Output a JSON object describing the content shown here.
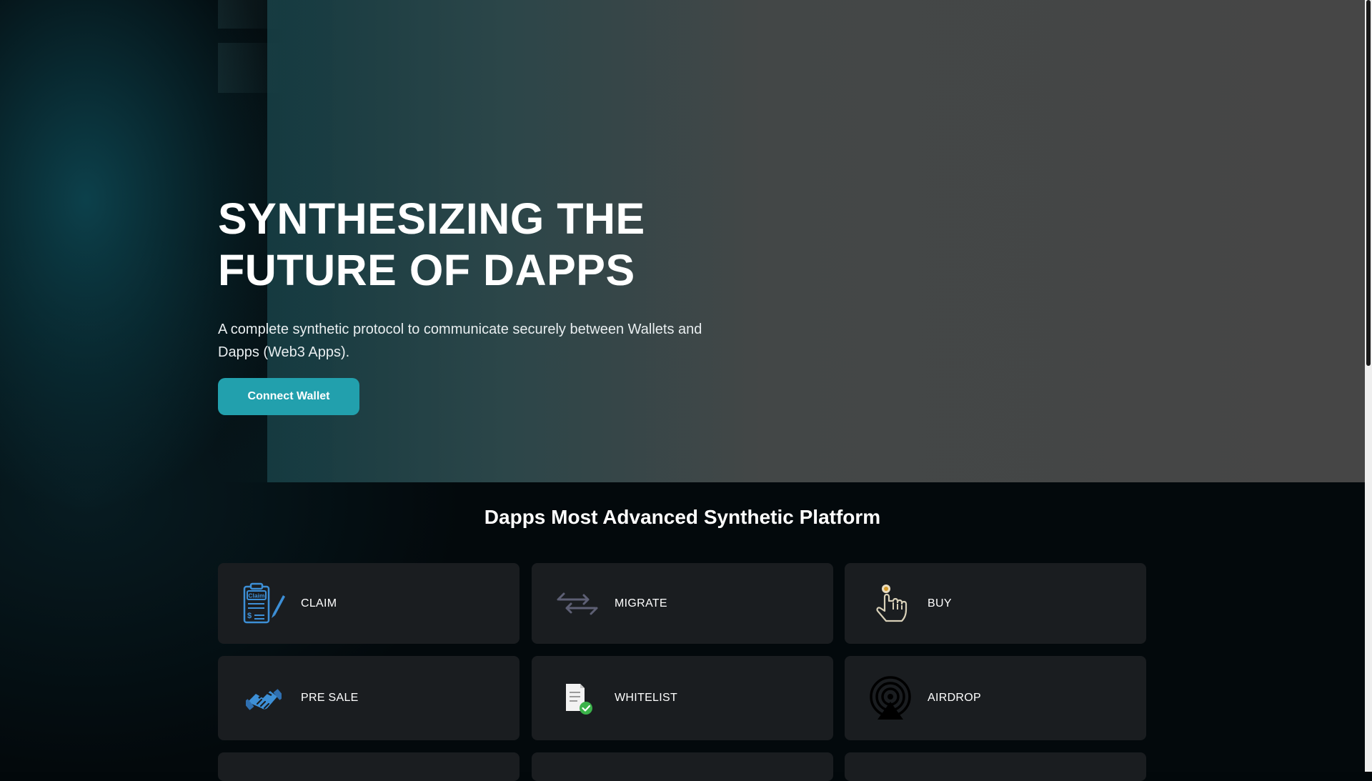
{
  "hero": {
    "title_line1": "SYNTHESIZING THE",
    "title_line2": "FUTURE OF DAPPS",
    "subtitle": "A complete synthetic protocol to communicate securely between Wallets and Dapps (Web3 Apps).",
    "connect_label": "Connect Wallet"
  },
  "section": {
    "title": "Dapps Most Advanced Synthetic Platform"
  },
  "cards": [
    {
      "label": "CLAIM",
      "icon": "claim-icon"
    },
    {
      "label": "MIGRATE",
      "icon": "migrate-icon"
    },
    {
      "label": "BUY",
      "icon": "buy-icon"
    },
    {
      "label": "PRE SALE",
      "icon": "presale-icon"
    },
    {
      "label": "WHITELIST",
      "icon": "whitelist-icon"
    },
    {
      "label": "AIRDROP",
      "icon": "airdrop-icon"
    }
  ],
  "colors": {
    "accent": "#22a0ad",
    "card_bg": "#1a1d20",
    "page_bg": "#03090c"
  }
}
